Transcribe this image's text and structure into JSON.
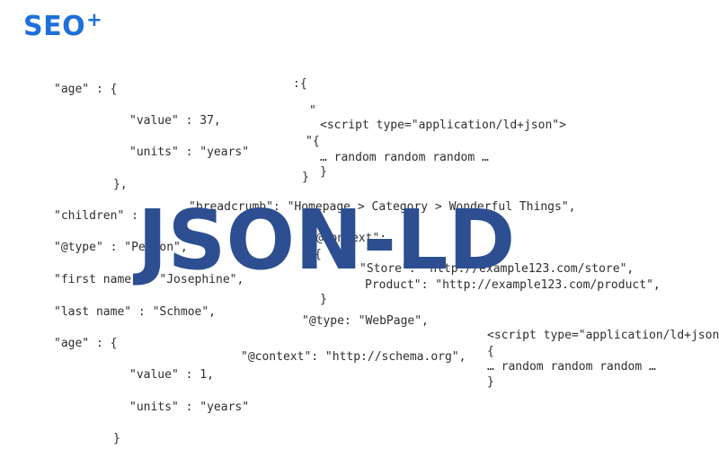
{
  "logo": {
    "text": "SEO",
    "plus": "+"
  },
  "headline": "JSON-LD",
  "code_left": [
    "\"age\" : {",
    "\"value\" : 37,",
    "\"units\" : \"years\"",
    "},",
    "\"children\" : [{",
    "\"@type\" : \"Person\",",
    "\"first name\" : \"Josephine\",",
    "\"last name\" : \"Schmoe\",",
    "\"age\" : {",
    "\"value\" : 1,",
    "\"units\" : \"years\"",
    "}"
  ],
  "code_right_top": [
    ":{",
    "\"",
    "<script type=\"application/ld+json\">",
    "\"{",
    "… random random random …",
    "}",
    "}"
  ],
  "code_middle": [
    "\"breadcrumb\": \"Homepage > Category > Wonderful Things\",",
    "\"@context\":",
    "{",
    "\"Store\": \"http://example123.com/store\",",
    "Product\": \"http://example123.com/product\",",
    "}",
    "\"@type: \"WebPage\",",
    "\"@context\": \"http://schema.org\","
  ],
  "code_right_bottom": [
    "<script type=\"application/ld+json",
    "{",
    "… random random random …",
    "}"
  ]
}
